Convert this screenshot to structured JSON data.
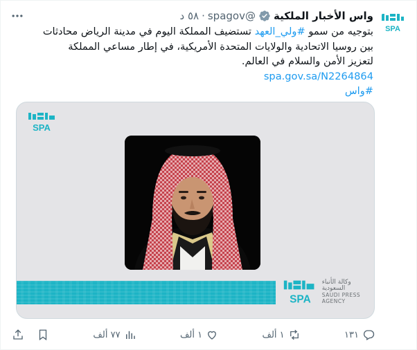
{
  "author": {
    "name": "واس الأخبار الملكية",
    "handle": "@spagov",
    "separator": "·",
    "time": "٥٨ د",
    "avatar_text": "SPA"
  },
  "tweet": {
    "prefix": "بتوجيه من سمو ",
    "hashtag_1": "#ولي_العهد",
    "text": " تستضيف المملكة اليوم في مدينة الرياض محادثات بين روسيا الاتحادية والولايات المتحدة الأمريكية، في إطار مساعي المملكة لتعزيز الأمن والسلام في العالم.",
    "link": "spa.gov.sa/N2264864",
    "hashtag_2": "#واس"
  },
  "card": {
    "logo_text": "SPA",
    "agency_ar": "وكالة الأنباء السعودية",
    "agency_en_1": "SAUDI PRESS",
    "agency_en_2": "AGENCY"
  },
  "actions": {
    "replies": "١٣١",
    "reposts": "١ ألف",
    "likes": "١ ألف",
    "views": "٧٧ ألف"
  },
  "colors": {
    "accent": "#1d9bf0",
    "verified": "#829aab",
    "teal": "#1db4c5",
    "muted": "#536471"
  }
}
